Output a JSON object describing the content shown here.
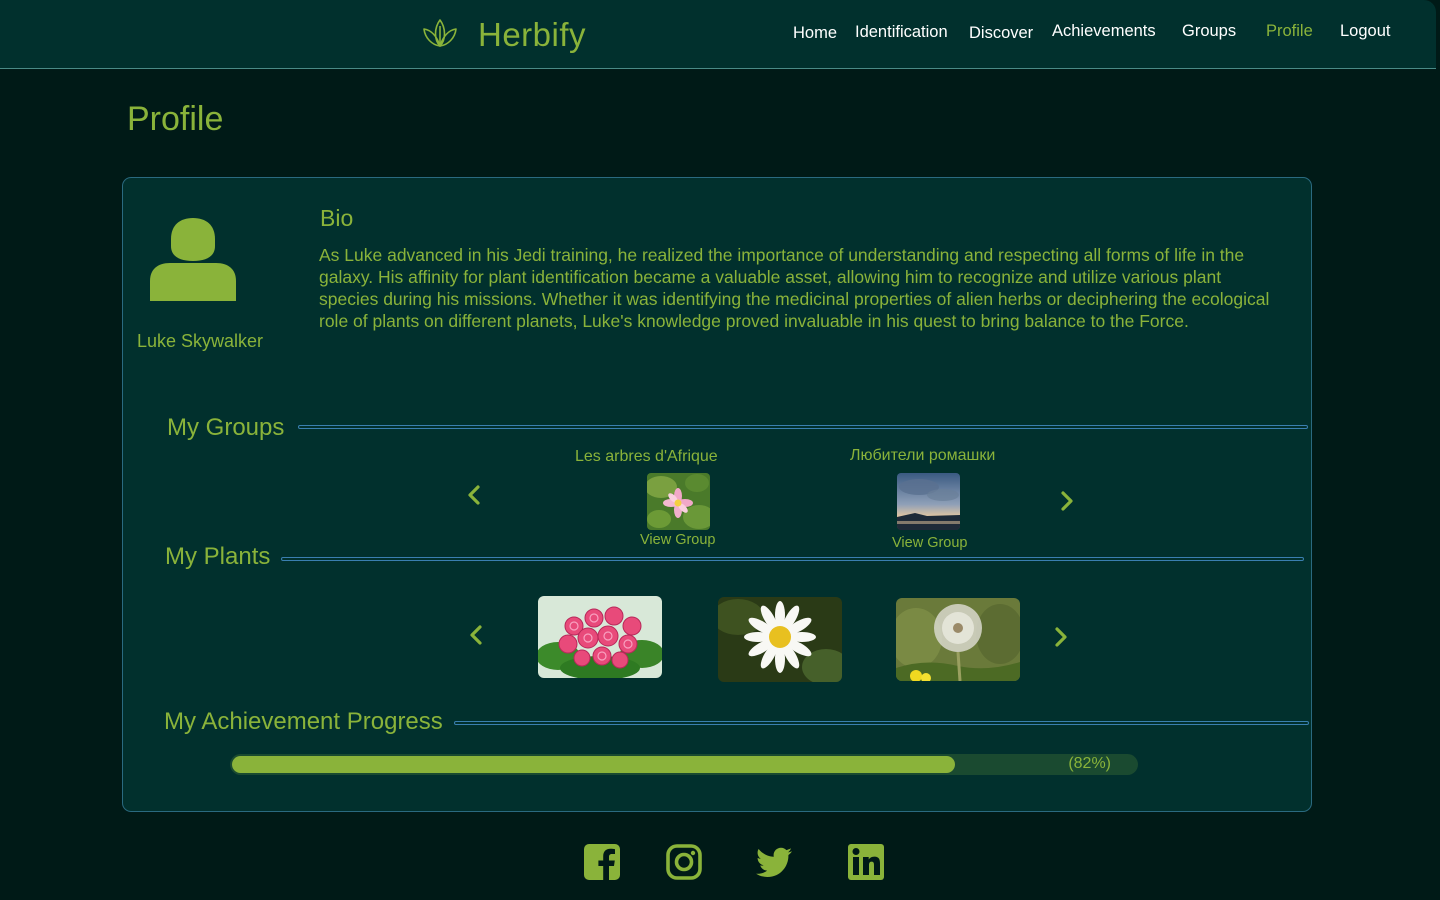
{
  "colors": {
    "accent": "#8ab33a",
    "background": "#001a17",
    "panel": "#01302d",
    "nav_text": "#ffffff",
    "rule": "#3a7fb0"
  },
  "header": {
    "brand": "Herbify",
    "brand_icon": "leaf-icon",
    "nav": {
      "home": "Home",
      "identification": "Identification",
      "discover": "Discover",
      "achievements": "Achievements",
      "groups": "Groups",
      "profile": "Profile",
      "logout": "Logout"
    },
    "active": "Profile"
  },
  "page": {
    "title": "Profile"
  },
  "profile": {
    "avatar_icon": "user-icon",
    "name": "Luke Skywalker",
    "bio_title": "Bio",
    "bio": "As Luke advanced in his Jedi training, he realized the importance of understanding and respecting all forms of life in the galaxy. His affinity for plant identification became a valuable asset, allowing him to recognize and utilize various plant species during his missions. Whether it was identifying the medicinal properties of alien herbs or deciphering the ecological role of plants on different planets, Luke's knowledge proved invaluable in his quest to bring balance to the Force."
  },
  "groups": {
    "title": "My Groups",
    "items": [
      {
        "name": "Les arbres d'Afrique",
        "action": "View Group",
        "image": "water-lily-photo"
      },
      {
        "name": "Любители ромашки",
        "action": "View Group",
        "image": "sunset-lake-photo"
      }
    ]
  },
  "plants": {
    "title": "My Plants",
    "items": [
      {
        "image": "pink-roses-photo"
      },
      {
        "image": "daisy-photo"
      },
      {
        "image": "dandelion-photo"
      }
    ]
  },
  "achievements": {
    "title": "My Achievement Progress",
    "progress": 82,
    "progress_label": "(82%)"
  },
  "social": [
    "facebook-icon",
    "instagram-icon",
    "twitter-icon",
    "linkedin-icon"
  ]
}
